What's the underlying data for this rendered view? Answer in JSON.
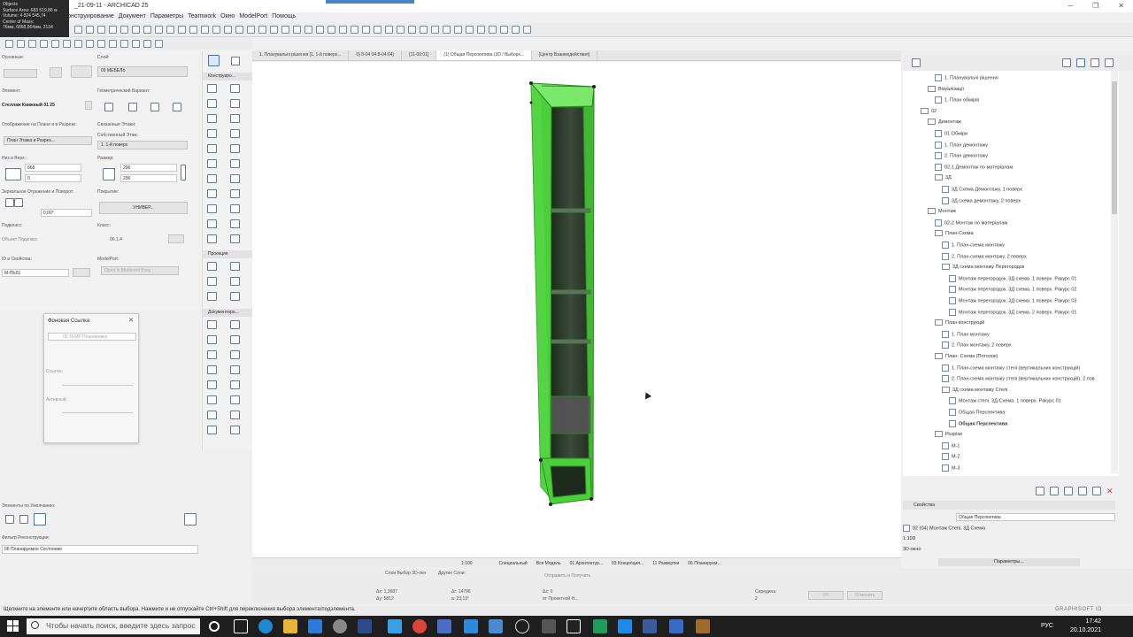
{
  "window": {
    "title": "_21-09-11 - ARCHICAD 25",
    "menu": [
      "Конструирование",
      "Документ",
      "Параметры",
      "Teamwork",
      "Окно",
      "ModelPort",
      "Помощь"
    ]
  },
  "objinfo": [
    "Objects",
    "Surface Area: 683 519,86 м",
    "Volume: 4 824 545,74",
    "Center of Mass:",
    "76мм, 6868,864мм, 2134"
  ],
  "info": {
    "osnovnye": "Основные:",
    "sloy": "Слой:",
    "layer_value": "09 МЕБЕЛЬ",
    "element": "Элемент:",
    "element_name": "Стеллаж Книжный 01 25",
    "geom_variant": "Геометрический Вариант:",
    "display_label": "Отображение на Плане и в Разрезе:",
    "display_value": "План Этажа и Разрез...",
    "own_floor": "Связанные Этажи:",
    "own_floor2": "Собственный Этаж:",
    "floor_value": "1. 1-й поверх",
    "height_label": "Низ и Верх:",
    "h1": "668",
    "h2": "0",
    "size_label": "Размер:",
    "s1": "296",
    "s2": "296",
    "mirror_label": "Зеркальное Отражение и Поворот:",
    "angle": "0,00°",
    "cover_label": "Покрытие:",
    "cover_value": "УНИВЕР...",
    "subset_label": "Подкласс:",
    "subset_value": "Объект Подкласс",
    "class_label": "Класс:",
    "class_value": "06.1.4",
    "id_label": "ID и Свойства:",
    "id_value": "M-ПЬ01",
    "modelport_label": "ModelPort:",
    "modelport_btn": "Open in Moderent Borg",
    "defaults_label": "Элементы по Умолчанию:",
    "filter_label": "Фильтр Реконструкции:",
    "filter_value": "06 Планируемое Состояние"
  },
  "toolbox": {
    "sections": [
      "Конструиро...",
      "Проекция",
      "Документиро..."
    ]
  },
  "palette": {
    "title": "Фоновая Ссылка",
    "item": "00 TEMP Планировка",
    "link_label": "Ссылка:",
    "active_label": "Активный:"
  },
  "tabs": [
    {
      "label": "1. Планувальні рішення [1. 1-й поверх...",
      "active": false
    },
    {
      "label": "0) 8-04 04:8-04:04)",
      "active": false
    },
    {
      "label": "[11-00:01]",
      "active": false
    },
    {
      "label": "(1) Общая Перспектива (3D / Выборк...",
      "active": true
    },
    {
      "label": "[Центр Взаимодействия]",
      "active": false
    }
  ],
  "navigator": {
    "items": [
      {
        "text": "1. Планувальні рішення",
        "depth": 3,
        "type": "sheet",
        "bold": false
      },
      {
        "text": "Візуалізації",
        "depth": 2,
        "type": "folder",
        "bold": false
      },
      {
        "text": "1. План обмірів",
        "depth": 3,
        "type": "sheet",
        "bold": false
      },
      {
        "text": "02",
        "depth": 1,
        "type": "folder",
        "bold": false
      },
      {
        "text": "Демонтаж",
        "depth": 2,
        "type": "folder",
        "bold": false
      },
      {
        "text": "01 Обміри",
        "depth": 3,
        "type": "sheet",
        "bold": false
      },
      {
        "text": "1. План демонтажу",
        "depth": 3,
        "type": "sheet",
        "bold": false
      },
      {
        "text": "2. План демонтажу",
        "depth": 3,
        "type": "sheet",
        "bold": false
      },
      {
        "text": "02-1 Демонтаж по матеріалам",
        "depth": 3,
        "type": "sheet",
        "bold": false
      },
      {
        "text": "3Д",
        "depth": 3,
        "type": "folder",
        "bold": false
      },
      {
        "text": "3Д Схема Демонтажу, 1 поверх",
        "depth": 4,
        "type": "sheet",
        "bold": false
      },
      {
        "text": "3Д схема демонтажу, 2 поверх",
        "depth": 4,
        "type": "sheet",
        "bold": false
      },
      {
        "text": "Монтаж",
        "depth": 2,
        "type": "folder",
        "bold": false
      },
      {
        "text": "02-2 Монтаж по матеріалам",
        "depth": 3,
        "type": "sheet",
        "bold": false
      },
      {
        "text": "План-Схема",
        "depth": 3,
        "type": "folder",
        "bold": false
      },
      {
        "text": "1. План-схема монтажу",
        "depth": 4,
        "type": "sheet",
        "bold": false
      },
      {
        "text": "2. План-схема монтажу, 2 поверх",
        "depth": 4,
        "type": "sheet",
        "bold": false
      },
      {
        "text": "3Д схема монтажу Перегородок",
        "depth": 4,
        "type": "folder",
        "bold": false
      },
      {
        "text": "Монтаж перегородок. 3Д схема. 1 поверх. Ракурс 01",
        "depth": 5,
        "type": "sheet",
        "bold": false
      },
      {
        "text": "Монтаж перегородок. 3Д схема. 1 поверх. Ракурс 02",
        "depth": 5,
        "type": "sheet",
        "bold": false
      },
      {
        "text": "Монтаж перегородок. 3Д схема. 1 поверх. Ракурс 03",
        "depth": 5,
        "type": "sheet",
        "bold": false
      },
      {
        "text": "Монтаж перегородок. 3Д схема. 2 поверх. Ракурс 01",
        "depth": 5,
        "type": "sheet",
        "bold": false
      },
      {
        "text": "План конструкцій",
        "depth": 3,
        "type": "folder",
        "bold": false
      },
      {
        "text": "1. План монтажу",
        "depth": 4,
        "type": "sheet",
        "bold": false
      },
      {
        "text": "2. План монтажу, 2 поверх",
        "depth": 4,
        "type": "sheet",
        "bold": false
      },
      {
        "text": "План- Схема (Потолок)",
        "depth": 3,
        "type": "folder",
        "bold": false
      },
      {
        "text": "1. План-схема монтажу стелі (вертикальних конструкцій)",
        "depth": 4,
        "type": "sheet",
        "bold": false
      },
      {
        "text": "2. План-схема монтажу стелі (вертикальних конструкцій). 2 пов",
        "depth": 4,
        "type": "sheet",
        "bold": false
      },
      {
        "text": "3Д схема монтажу Стелі",
        "depth": 4,
        "type": "folder",
        "bold": false
      },
      {
        "text": "Монтаж стелі. 3Д-Схема. 1 поверх. Ракурс 01",
        "depth": 5,
        "type": "sheet",
        "bold": false
      },
      {
        "text": "Общая Перспектива",
        "depth": 5,
        "type": "sheet",
        "bold": false
      },
      {
        "text": "Общая Перспектива",
        "depth": 5,
        "type": "sheet",
        "bold": true
      },
      {
        "text": "Розрізи",
        "depth": 3,
        "type": "folder",
        "bold": false
      },
      {
        "text": "M-1",
        "depth": 4,
        "type": "sheet",
        "bold": false
      },
      {
        "text": "M-2",
        "depth": 4,
        "type": "sheet",
        "bold": false
      },
      {
        "text": "M-3",
        "depth": 4,
        "type": "sheet",
        "bold": false
      }
    ]
  },
  "properties": {
    "header": "Свойства",
    "name_value": "Общая Перспектива",
    "rows": [
      "02 (04) Монтаж Стелі. 3Д Схема",
      "1:100",
      "3D-окно"
    ],
    "params_btn": "Параметры..."
  },
  "viewbar": [
    "1:100",
    "Специальный",
    "Вся Модель",
    "01 Архитектур...",
    "03 Концепция...",
    "11 Развертки",
    "06 Планируем..."
  ],
  "coords": {
    "ax": "Δx: 1,3687",
    "ay": "Δy: 5812",
    "ar": "Δr: 14796",
    "aa": "a: 23,13°",
    "az": "Δz: 0",
    "proj": "от Проектной Н...",
    "mid": "Середина",
    "mid2": "2",
    "ok": "OK",
    "cancel": "Отменить",
    "sel1": "Слои Выбор 3D-окн",
    "sel2": "Другие Слои:",
    "sel3": "Отправить и Получить"
  },
  "statusbar": "Щелкните на элементе или начертите область выбора. Нажмите и не отпускайте Ctrl+Shift для переключения выбора элемента/подэлемента.",
  "brand": "GRAPHISOFT ID",
  "taskbar": {
    "search": "Чтобы начать поиск, введите здесь запрос",
    "lang": "РУС",
    "time": "17:42",
    "date": "20.10.2021"
  }
}
